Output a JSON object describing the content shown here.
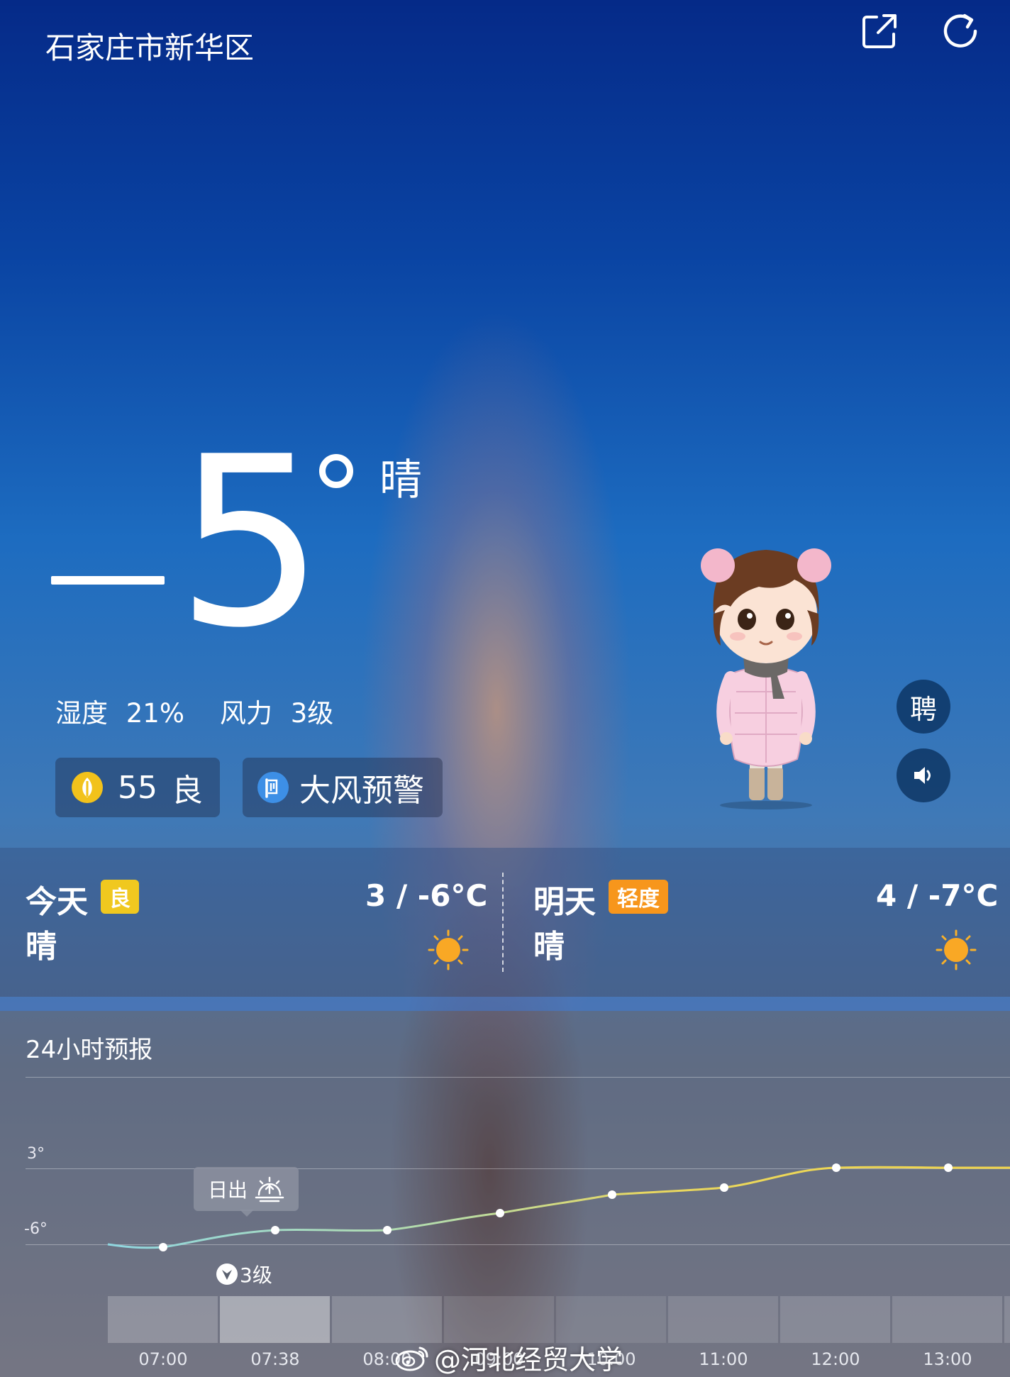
{
  "header": {
    "city": "石家庄市新华区",
    "share_icon": "share-icon",
    "refresh_icon": "refresh-icon"
  },
  "current": {
    "temperature_sign": "−",
    "temperature_value": "5",
    "condition": "晴",
    "humidity_label": "湿度",
    "humidity_value": "21%",
    "wind_label": "风力",
    "wind_value": "3级",
    "aqi_value": "55",
    "aqi_level": "良",
    "warning_text": "大风预警"
  },
  "side_buttons": {
    "recruit_label": "聘",
    "speaker_icon": "speaker-icon"
  },
  "daily": {
    "today": {
      "label": "今天",
      "aqi_badge": "良",
      "badge_color": "#f0c81f",
      "temps": "3 / -6°C",
      "condition": "晴"
    },
    "tomorrow": {
      "label": "明天",
      "aqi_badge": "轻度",
      "badge_color": "#f7961c",
      "temps": "4 / -7°C",
      "condition": "晴"
    }
  },
  "hourly": {
    "title": "24小时预报",
    "axis_high": "3°",
    "axis_low": "-6°",
    "sunrise_label": "日出",
    "wind_marker": "3级",
    "times": [
      "07:00",
      "07:38",
      "08:00",
      "09:00",
      "10:00",
      "11:00",
      "12:00",
      "13:00"
    ],
    "colors": {
      "cold": "#8fd6e0",
      "warm": "#f2d64b"
    }
  },
  "watermark": "@河北经贸大学"
}
